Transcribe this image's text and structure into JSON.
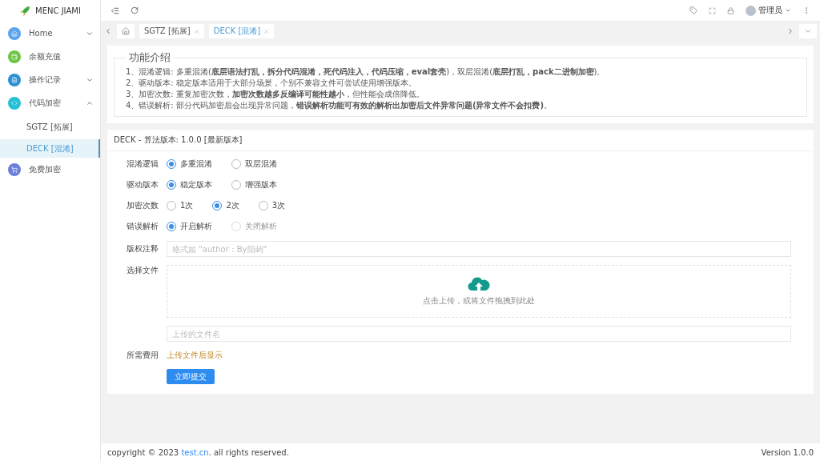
{
  "logo": {
    "title": "MENC JIAMI"
  },
  "sidebar": {
    "items": [
      {
        "label": "Home",
        "color": "#5aa3ee",
        "kind": "group",
        "expanded": false,
        "selected": false
      },
      {
        "label": "余额充值",
        "color": "#6cc644",
        "kind": "item",
        "selected": false
      },
      {
        "label": "操作记录",
        "color": "#2b8fd3",
        "kind": "group",
        "expanded": false,
        "selected": false
      },
      {
        "label": "代码加密",
        "color": "#27c1d6",
        "kind": "group",
        "expanded": true,
        "selected": false,
        "children": [
          {
            "label": "SGTZ [拓展]",
            "selected": false
          },
          {
            "label": "DECK [混淆]",
            "selected": true
          }
        ]
      },
      {
        "label": "免费加密",
        "color": "#6b7fd8",
        "kind": "item",
        "selected": false
      }
    ]
  },
  "header": {
    "user": "管理员"
  },
  "tabs": [
    {
      "label": "SGTZ [拓展]",
      "selected": false
    },
    {
      "label": "DECK [混淆]",
      "selected": true
    }
  ],
  "intro": {
    "title": "功能介绍",
    "lines": [
      "1、混淆逻辑: 多重混淆(**底层语法打乱，拆分代码混淆，死代码注入，代码压缩，eval套壳**)，双层混淆(**底层打乱，pack二进制加密**)。",
      "2、驱动版本: 稳定版本适用于大部分场景，个别不兼容文件可尝试使用增强版本。",
      "3、加密次数: 重复加密次数，**加密次数越多反编译可能性越小**，但性能会成倍降低。",
      "4、错误解析: 部分代码加密后会出现异常问题，**错误解析功能可有效的解析出加密后文件异常问题(异常文件不会扣费)**。"
    ]
  },
  "form": {
    "title": "DECK - 算法版本: 1.0.0 [最新版本]",
    "radio_groups": [
      {
        "label": "混淆逻辑",
        "options": [
          {
            "label": "多重混淆",
            "selected": true,
            "disabled": false
          },
          {
            "label": "双层混淆",
            "selected": false,
            "disabled": false
          }
        ]
      },
      {
        "label": "驱动版本",
        "options": [
          {
            "label": "稳定版本",
            "selected": true,
            "disabled": false
          },
          {
            "label": "增强版本",
            "selected": false,
            "disabled": false
          }
        ]
      },
      {
        "label": "加密次数",
        "options": [
          {
            "label": "1次",
            "selected": false,
            "disabled": false
          },
          {
            "label": "2次",
            "selected": true,
            "disabled": false
          },
          {
            "label": "3次",
            "selected": false,
            "disabled": false
          }
        ]
      },
      {
        "label": "错误解析",
        "options": [
          {
            "label": "开启解析",
            "selected": true,
            "disabled": false
          },
          {
            "label": "关闭解析",
            "selected": false,
            "disabled": true
          }
        ]
      }
    ],
    "copyright": {
      "label": "版权注释",
      "placeholder": "格式如 \"author：By陌屿\""
    },
    "file": {
      "label": "选择文件",
      "hint": "点击上传，或将文件拖拽到此处",
      "placeholder": "上传的文件名"
    },
    "fee": {
      "label": "所需费用",
      "value": "上传文件后显示"
    },
    "submit": "立即提交"
  },
  "footer": {
    "copyright": "copyright © 2023 ",
    "link": "test.cn",
    "rest": ". all rights reserved.",
    "version": "Version 1.0.0"
  }
}
